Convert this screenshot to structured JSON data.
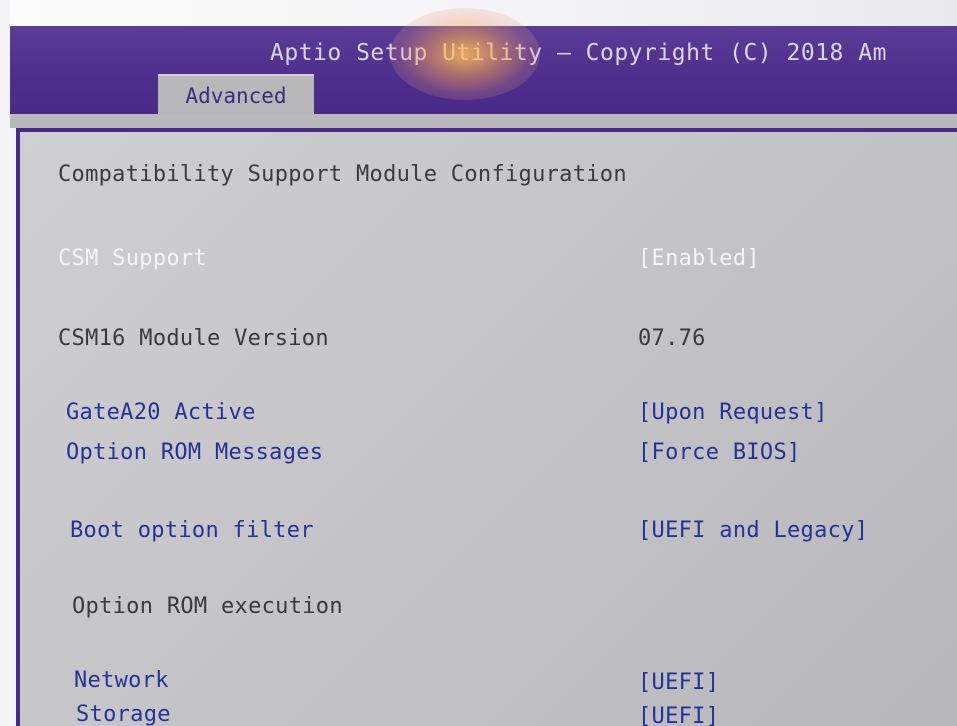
{
  "header": {
    "title": "Aptio Setup Utility – Copyright (C) 2018 Am",
    "active_tab": "Advanced"
  },
  "content": {
    "heading": "Compatibility Support Module Configuration",
    "items": [
      {
        "label": "CSM Support",
        "value": "[Enabled]"
      },
      {
        "label": "CSM16 Module Version",
        "value": "07.76"
      },
      {
        "label": "GateA20 Active",
        "value": "[Upon Request]"
      },
      {
        "label": "Option ROM Messages",
        "value": "[Force BIOS]"
      },
      {
        "label": "Boot option filter",
        "value": "[UEFI and Legacy]"
      }
    ],
    "section": "Option ROM execution",
    "rom_items": [
      {
        "label": "Network",
        "value": "[UEFI]"
      },
      {
        "label": "Storage",
        "value": "[UEFI]"
      }
    ]
  },
  "colors": {
    "title_bar": "#4f2f8d",
    "panel": "#c4c4c7",
    "tab": "#b7b7ba",
    "option_text": "#25329a",
    "selected_text": "#f4f4f6",
    "static_text": "#3a3a3c"
  }
}
